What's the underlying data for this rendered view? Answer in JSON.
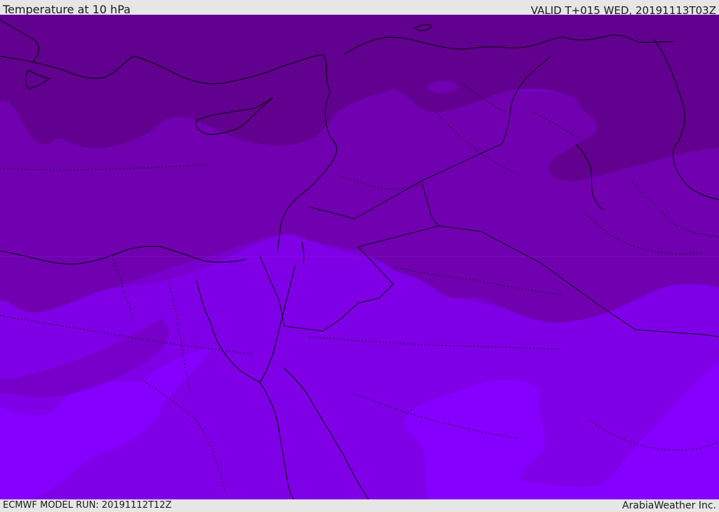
{
  "header": {
    "title": "Temperature at 10 hPa",
    "valid": "VALID T+015 WED, 20191113T03Z"
  },
  "footer": {
    "model_run": "ECMWF MODEL RUN: 20191112T12Z",
    "brand": "ArabiaWeather Inc."
  },
  "colors": {
    "band_coldest": "#62008f",
    "band_cold": "#7000b0",
    "band_mid": "#7800cc",
    "band_warm": "#7f00e6",
    "band_warmest": "#8600ff",
    "coastline": "#000000",
    "border": "#1a1a1a"
  }
}
